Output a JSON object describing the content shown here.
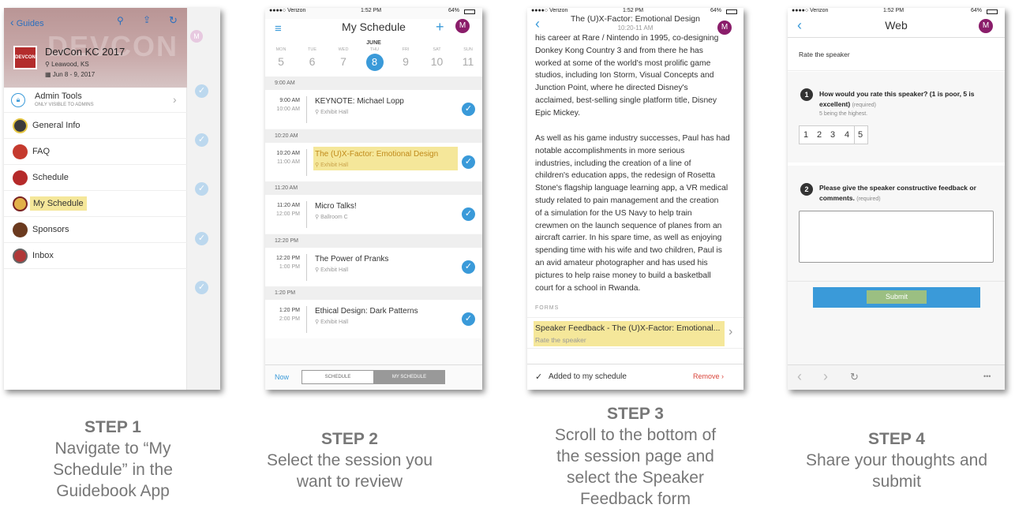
{
  "steps": [
    {
      "heading": "STEP 1",
      "line1": "Navigate to “My",
      "line2": "Schedule” in the",
      "line3": "Guidebook App"
    },
    {
      "heading": "STEP 2",
      "line1": "Select the session you",
      "line2": "want to review"
    },
    {
      "heading": "STEP 3",
      "line1": "Scroll to the bottom of",
      "line2": "the session page and",
      "line3": "select the Speaker",
      "line4": "Feedback form"
    },
    {
      "heading": "STEP 4",
      "line1": "Share your thoughts and",
      "line2": "submit"
    }
  ],
  "phone1": {
    "back_label": "Guides",
    "avatar": "M",
    "event_title": "DevCon KC 2017",
    "logo_text": "DEVCON",
    "location": "Leawood, KS",
    "dates": "Jun 8 - 9, 2017",
    "admin_title": "Admin Tools",
    "admin_sub": "ONLY VISIBLE TO ADMINS",
    "menu": [
      "General Info",
      "FAQ",
      "Schedule",
      "My Schedule",
      "Sponsors",
      "Inbox"
    ],
    "colors": {
      "highlight": "#f5e79a",
      "accent": "#3a9ad9"
    }
  },
  "phone2": {
    "status": {
      "carrier": "●●●●○ Verizon",
      "time": "1:52 PM",
      "battery": "64%"
    },
    "title": "My Schedule",
    "avatar": "M",
    "month": "JUNE",
    "days": [
      {
        "d": "MON",
        "n": "5"
      },
      {
        "d": "TUE",
        "n": "6"
      },
      {
        "d": "WED",
        "n": "7"
      },
      {
        "d": "THU",
        "n": "8"
      },
      {
        "d": "FRI",
        "n": "9"
      },
      {
        "d": "SAT",
        "n": "10"
      },
      {
        "d": "SUN",
        "n": "11"
      }
    ],
    "sessions": [
      {
        "header": "9:00 AM",
        "start": "9:00 AM",
        "end": "10:00 AM",
        "name": "KEYNOTE: Michael Lopp",
        "loc": "Exhibit Hall"
      },
      {
        "header": "10:20 AM",
        "start": "10:20 AM",
        "end": "11:00 AM",
        "name": "The (U)X-Factor: Emotional Design",
        "loc": "Exhibit Hall"
      },
      {
        "header": "11:20 AM",
        "start": "11:20 AM",
        "end": "12:00 PM",
        "name": "Micro Talks!",
        "loc": "Ballroom C"
      },
      {
        "header": "12:20 PM",
        "start": "12:20 PM",
        "end": "1:00 PM",
        "name": "The Power of Pranks",
        "loc": "Exhibit Hall"
      },
      {
        "header": "1:20 PM",
        "start": "1:20 PM",
        "end": "2:00 PM",
        "name": "Ethical Design: Dark Patterns",
        "loc": "Exhibit Hall"
      }
    ],
    "tab_now": "Now",
    "tab_schedule": "SCHEDULE",
    "tab_my": "MY SCHEDULE"
  },
  "phone3": {
    "status": {
      "carrier": "●●●●○ Verizon",
      "time": "1:52 PM",
      "battery": "64%"
    },
    "title": "The (U)X-Factor: Emotional Design",
    "subtitle": "10:20-11 AM",
    "avatar": "M",
    "para1": [
      "his career at Rare / Nintendo in 1995, co-designing",
      "Donkey Kong Country 3 and from there he has",
      "worked at some of the world's most prolific game",
      "studios, including Ion Storm, Visual Concepts and",
      "Junction Point, where he directed Disney's",
      "acclaimed, best-selling single platform title, Disney",
      "Epic Mickey."
    ],
    "para2": [
      "As well as his game industry successes, Paul has had",
      "notable accomplishments in more serious",
      "industries, including the creation of a line of",
      "children's education apps, the redesign of Rosetta",
      "Stone's flagship language learning app, a VR medical",
      "study related to pain management and the creation",
      "of a simulation for the US Navy to help train",
      "crewmen on the launch sequence of planes from an",
      "aircraft carrier. In his spare time, as well as enjoying",
      "spending time with his wife and two children, Paul is",
      "an avid amateur photographer and has used his",
      "pictures to help raise money to build a basketball",
      "court for a school in Rwanda."
    ],
    "forms_label": "FORMS",
    "form_title": "Speaker Feedback - The (U)X-Factor: Emotional...",
    "form_sub": "Rate the speaker",
    "added": "Added to my schedule",
    "remove": "Remove"
  },
  "phone4": {
    "status": {
      "carrier": "●●●●○ Verizon",
      "time": "1:52 PM",
      "battery": "64%"
    },
    "title": "Web",
    "avatar": "M",
    "heading": "Rate the speaker",
    "q1_num": "1",
    "q1": "How would you rate this speaker? (1 is poor, 5 is excellent)",
    "q1_req": "(required)",
    "q1_hint": "5 being the highest.",
    "ratings": [
      "1",
      "2",
      "3",
      "4",
      "5"
    ],
    "q2_num": "2",
    "q2": "Please give the speaker constructive feedback or comments.",
    "q2_req": "(required)",
    "submit": "Submit",
    "more": "•••"
  }
}
